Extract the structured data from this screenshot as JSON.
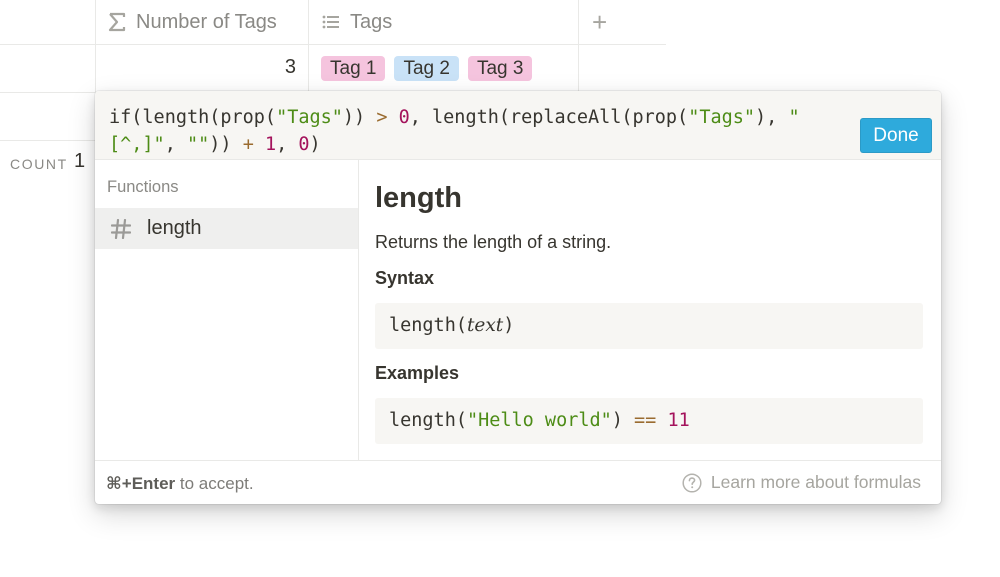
{
  "table": {
    "columns": [
      {
        "label": "Number of Tags",
        "icon": "sigma-icon"
      },
      {
        "label": "Tags",
        "icon": "list-icon"
      }
    ],
    "add_column_icon": "+",
    "row": {
      "number_of_tags": "3",
      "tags": [
        {
          "label": "Tag 1",
          "color": "#f5c4de"
        },
        {
          "label": "Tag 2",
          "color": "#c9e2f7"
        },
        {
          "label": "Tag 3",
          "color": "#f5c4de"
        }
      ]
    },
    "count_label": "COUNT",
    "count_value": "1"
  },
  "formula_editor": {
    "done_label": "Done",
    "formula_tokens": [
      {
        "t": "if(length(prop(",
        "k": "p"
      },
      {
        "t": "\"Tags\"",
        "k": "s"
      },
      {
        "t": ")) ",
        "k": "p"
      },
      {
        "t": ">",
        "k": "o"
      },
      {
        "t": " ",
        "k": "p"
      },
      {
        "t": "0",
        "k": "n"
      },
      {
        "t": ", length(replaceAll(prop(",
        "k": "p"
      },
      {
        "t": "\"Tags\"",
        "k": "s"
      },
      {
        "t": "), ",
        "k": "p"
      },
      {
        "t": "\"[^,]\"",
        "k": "s"
      },
      {
        "t": ", ",
        "k": "p"
      },
      {
        "t": "\"\"",
        "k": "s"
      },
      {
        "t": ")) ",
        "k": "p"
      },
      {
        "t": "+",
        "k": "o"
      },
      {
        "t": " ",
        "k": "p"
      },
      {
        "t": "1",
        "k": "n"
      },
      {
        "t": ", ",
        "k": "p"
      },
      {
        "t": "0",
        "k": "n"
      },
      {
        "t": ")",
        "k": "p"
      }
    ],
    "functions_heading": "Functions",
    "functions": [
      {
        "name": "length",
        "icon": "hash-icon",
        "selected": true
      }
    ],
    "detail": {
      "title": "length",
      "description": "Returns the length of a string.",
      "syntax_heading": "Syntax",
      "syntax_fn": "length(",
      "syntax_arg": "text",
      "syntax_close": ")",
      "examples_heading": "Examples",
      "example_tokens": [
        {
          "t": "length(",
          "k": "p"
        },
        {
          "t": "\"Hello world\"",
          "k": "s"
        },
        {
          "t": ") ",
          "k": "p"
        },
        {
          "t": "==",
          "k": "o"
        },
        {
          "t": " ",
          "k": "p"
        },
        {
          "t": "11",
          "k": "n"
        }
      ]
    },
    "footer": {
      "hint_keys": "⌘+Enter",
      "hint_text": " to accept.",
      "learn_more": "Learn more about formulas"
    }
  },
  "colors": {
    "accent": "#2eaadc",
    "string": "#4d8c16",
    "number": "#a4135c",
    "operator": "#9a6b2f"
  }
}
